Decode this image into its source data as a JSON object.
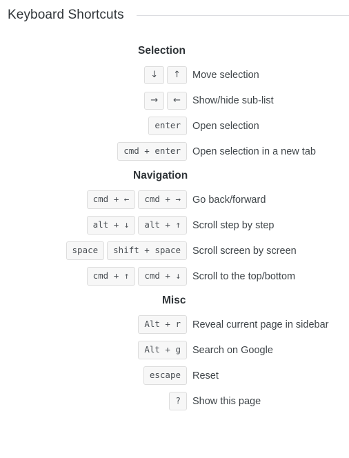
{
  "header": {
    "title": "Keyboard Shortcuts"
  },
  "sections": [
    {
      "id": "selection",
      "heading": "Selection",
      "rows": [
        {
          "keys": [
            "↓",
            "↑"
          ],
          "key_types": [
            "arrow",
            "arrow"
          ],
          "description": "Move selection"
        },
        {
          "keys": [
            "→",
            "←"
          ],
          "key_types": [
            "arrow",
            "arrow"
          ],
          "description": "Show/hide sub-list"
        },
        {
          "keys": [
            "enter"
          ],
          "key_types": [
            "text"
          ],
          "description": "Open selection"
        },
        {
          "keys": [
            "cmd + enter"
          ],
          "key_types": [
            "text"
          ],
          "description": "Open selection in a new tab"
        }
      ]
    },
    {
      "id": "navigation",
      "heading": "Navigation",
      "rows": [
        {
          "keys": [
            "cmd + ←",
            "cmd + →"
          ],
          "key_types": [
            "text",
            "text"
          ],
          "description": "Go back/forward"
        },
        {
          "keys": [
            "alt + ↓",
            "alt + ↑"
          ],
          "key_types": [
            "text",
            "text"
          ],
          "description": "Scroll step by step"
        },
        {
          "keys": [
            "space",
            "shift + space"
          ],
          "key_types": [
            "text",
            "text"
          ],
          "description": "Scroll screen by screen"
        },
        {
          "keys": [
            "cmd + ↑",
            "cmd + ↓"
          ],
          "key_types": [
            "text",
            "text"
          ],
          "description": "Scroll to the top/bottom"
        }
      ]
    },
    {
      "id": "misc",
      "heading": "Misc",
      "rows": [
        {
          "keys": [
            "Alt + r"
          ],
          "key_types": [
            "text"
          ],
          "description": "Reveal current page in sidebar"
        },
        {
          "keys": [
            "Alt + g"
          ],
          "key_types": [
            "text"
          ],
          "description": "Search on Google"
        },
        {
          "keys": [
            "escape"
          ],
          "key_types": [
            "text"
          ],
          "description": "Reset"
        },
        {
          "keys": [
            "?"
          ],
          "key_types": [
            "text"
          ],
          "description": "Show this page"
        }
      ]
    }
  ],
  "colors": {
    "page_background": "#ffffff",
    "title_text": "#2f3438",
    "rule": "#dcdde1",
    "keycap_background": "#f7f7f7",
    "keycap_border": "#dddddd",
    "keycap_text": "#4a4f54",
    "description_text": "#3f4549"
  }
}
